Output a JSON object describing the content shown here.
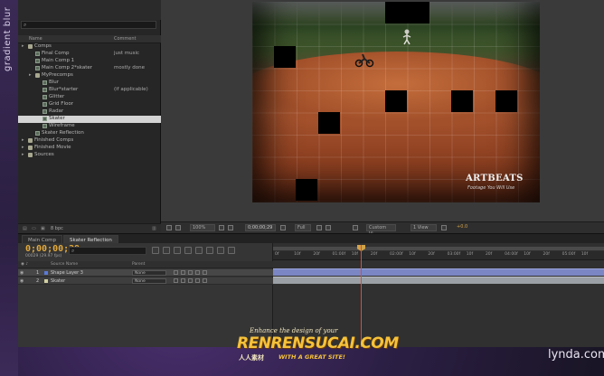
{
  "sidebar_caption": "gradient blur",
  "project": {
    "columns": {
      "name": "Name",
      "comment": "Comment"
    },
    "items": [
      {
        "label": "Comps",
        "type": "folder",
        "indent": 0,
        "comment": ""
      },
      {
        "label": "Final Comp",
        "type": "comp",
        "indent": 1,
        "comment": "just music"
      },
      {
        "label": "Main Comp 1",
        "type": "comp",
        "indent": 1,
        "comment": ""
      },
      {
        "label": "Main Comp 2*skater",
        "type": "comp",
        "indent": 1,
        "comment": "mostly done"
      },
      {
        "label": "MyPrecomps",
        "type": "folder",
        "indent": 1,
        "comment": ""
      },
      {
        "label": "Blur",
        "type": "comp",
        "indent": 2,
        "comment": ""
      },
      {
        "label": "Blur*starter",
        "type": "comp",
        "indent": 2,
        "comment": "(if applicable)"
      },
      {
        "label": "Glitter",
        "type": "comp",
        "indent": 2,
        "comment": ""
      },
      {
        "label": "Grid Floor",
        "type": "comp",
        "indent": 2,
        "comment": ""
      },
      {
        "label": "Radar",
        "type": "comp",
        "indent": 2,
        "comment": ""
      },
      {
        "label": "Skater",
        "type": "comp",
        "indent": 2,
        "comment": "",
        "selected": true
      },
      {
        "label": "Wireframe",
        "type": "comp",
        "indent": 2,
        "comment": ""
      },
      {
        "label": "Skater Reflection",
        "type": "comp",
        "indent": 1,
        "comment": ""
      },
      {
        "label": "Finished Comps",
        "type": "folder",
        "indent": 0,
        "comment": ""
      },
      {
        "label": "Finished Movie",
        "type": "folder",
        "indent": 0,
        "comment": ""
      },
      {
        "label": "Sources",
        "type": "folder",
        "indent": 0,
        "comment": ""
      }
    ],
    "bit_depth": "8 bpc"
  },
  "viewer": {
    "zoom": "100%",
    "timecode": "0;00;00;29",
    "resolution": "Full",
    "camera": "Custom Vi...",
    "view_layout": "1 View",
    "exposure": "+0.0",
    "logo_title": "ARTBEATS",
    "logo_sub": "Footage You Will Use"
  },
  "timeline": {
    "tabs": [
      "Main Comp",
      "Skater Reflection"
    ],
    "active_tab": 1,
    "timecode": "0;00;00;29",
    "timecode_sub": "00029 (29.97 fps)",
    "search_placeholder": "",
    "column_source": "Source Name",
    "column_parent": "Parent",
    "ruler": [
      "0f",
      "10f",
      "20f",
      "01:00f",
      "10f",
      "20f",
      "02:00f",
      "10f",
      "20f",
      "03:00f",
      "10f",
      "20f",
      "04:00f",
      "10f",
      "20f",
      "05:00f",
      "10f"
    ],
    "layers": [
      {
        "num": "1",
        "name": "Shape Layer 3",
        "parent": "None",
        "label_color": "#5a7ad6"
      },
      {
        "num": "2",
        "name": "Skater",
        "parent": "None",
        "label_color": "#d0d0a0"
      }
    ]
  },
  "watermark": {
    "tagline": "Enhance the design of your",
    "brand": "RENRENSUCAI.COM",
    "cn": "人人素材",
    "slogan": "WITH A GREAT SITE!"
  },
  "lynda": "lynda.com"
}
